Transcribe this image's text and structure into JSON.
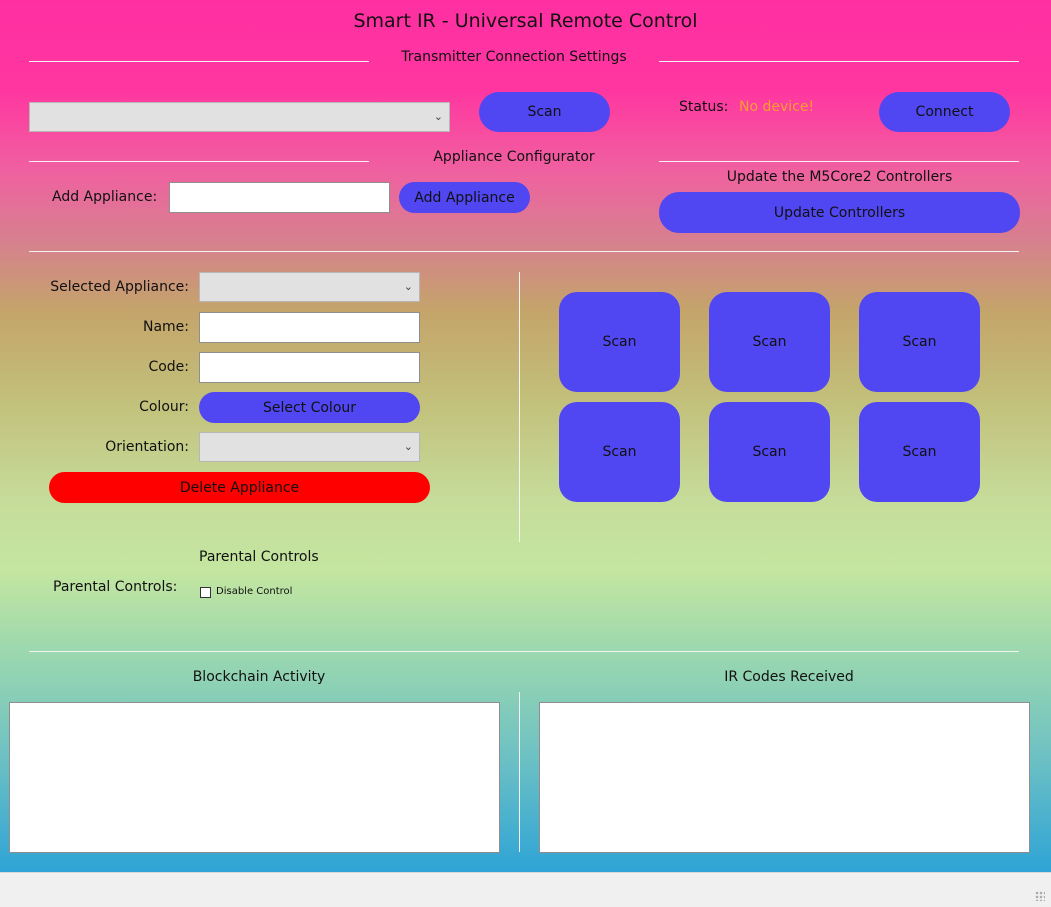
{
  "app": {
    "title": "Smart IR - Universal Remote Control"
  },
  "transmitter": {
    "section_title": "Transmitter Connection Settings",
    "device_selected": "",
    "scan_label": "Scan",
    "status_label": "Status:",
    "status_value": "No device!",
    "status_color": "#ff9d2e",
    "connect_label": "Connect"
  },
  "configurator": {
    "section_title": "Appliance Configurator",
    "add_label": "Add Appliance:",
    "add_value": "",
    "add_button": "Add Appliance"
  },
  "controllers": {
    "section_title": "Update the M5Core2 Controllers",
    "update_button": "Update Controllers"
  },
  "appliance": {
    "selected_label": "Selected Appliance:",
    "selected_value": "",
    "name_label": "Name:",
    "name_value": "",
    "code_label": "Code:",
    "code_value": "",
    "colour_label": "Colour:",
    "colour_button": "Select Colour",
    "orientation_label": "Orientation:",
    "orientation_value": "",
    "delete_button": "Delete Appliance",
    "delete_color": "#ff0000"
  },
  "scan_tiles": [
    "Scan",
    "Scan",
    "Scan",
    "Scan",
    "Scan",
    "Scan"
  ],
  "parental": {
    "section_title": "Parental Controls",
    "label": "Parental Controls:",
    "checkbox_label": "Disable Control",
    "checked": false
  },
  "logs": {
    "blockchain_title": "Blockchain Activity",
    "ir_title": "IR Codes Received"
  },
  "colors": {
    "button": "#5046f2",
    "accent_top": "#ff2fa2",
    "accent_bottom": "#2ea4d6"
  }
}
